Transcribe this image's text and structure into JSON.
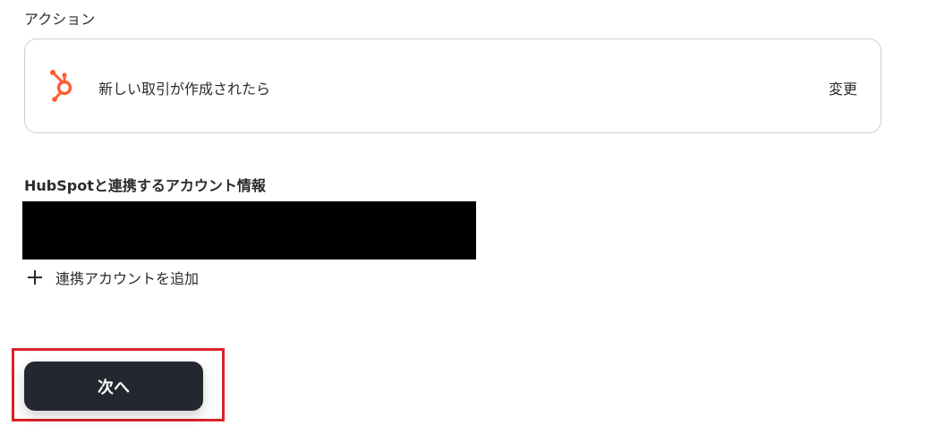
{
  "action_section": {
    "label": "アクション",
    "card": {
      "icon": "hubspot-icon",
      "icon_color": "#ff5c35",
      "text": "新しい取引が作成されたら",
      "change_label": "変更"
    }
  },
  "account_section": {
    "label": "HubSpotと連携するアカウント情報",
    "add_account_label": "連携アカウントを追加"
  },
  "footer": {
    "next_label": "次へ",
    "highlight_color": "#d9232a",
    "button_color": "#232830"
  }
}
